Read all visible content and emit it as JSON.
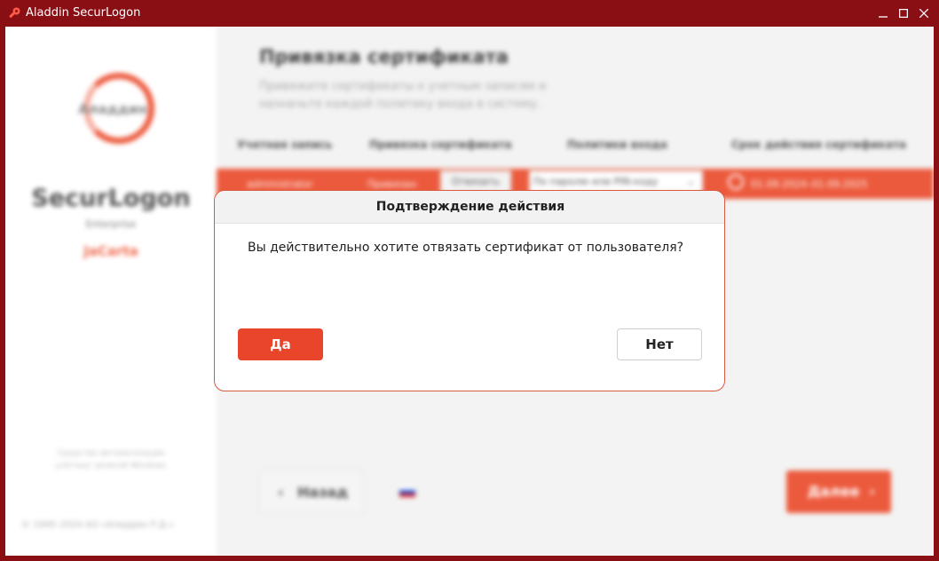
{
  "window": {
    "title": "Aladdin SecurLogon",
    "app_icon": "aladdin-key-icon",
    "controls": [
      "minimize-icon",
      "maximize-icon",
      "close-icon"
    ],
    "frame_color": "#8a0f14"
  },
  "sidebar": {
    "logo_text": "Аладдин",
    "product": "SecurLogon",
    "edition": "Enterprise",
    "token": "JaCarta",
    "note": "Средство автоматизации учётных записей Windows",
    "copyright": "© 1995–2024 АО «Аладдин Р.Д.»"
  },
  "main": {
    "title": "Привязка сертификата",
    "subtitle": "Привяжите сертификаты к учетным записям и назначьте каждой политику входа в систему.",
    "columns": [
      "Учетная запись",
      "Привязка сертификата",
      "Политики входа",
      "Срок действия сертификата"
    ],
    "row": {
      "account": "administrator",
      "binding_status": "Привязан",
      "unbind_label": "Отвязать",
      "policy": "По паролю или PIN-коду",
      "validity": "01.09.2024–01.09.2025"
    }
  },
  "footer": {
    "back_label": "Назад",
    "next_label": "Далее",
    "language_flag": "ru-flag-icon"
  },
  "dialog": {
    "title": "Подтверждение действия",
    "message": "Вы действительно хотите отвязать сертификат от пользователя?",
    "yes_label": "Да",
    "no_label": "Нет"
  },
  "colors": {
    "accent": "#e8452a",
    "row_highlight": "#ec5a3d"
  }
}
